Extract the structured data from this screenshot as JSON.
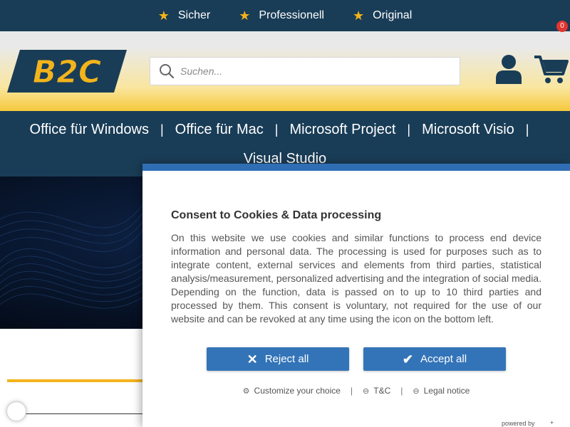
{
  "topbar": {
    "items": [
      {
        "icon": "star-icon",
        "label": "Sicher"
      },
      {
        "icon": "star-icon",
        "label": "Professionell"
      },
      {
        "icon": "star-icon",
        "label": "Original"
      }
    ]
  },
  "header": {
    "logo_text": "B2C",
    "search": {
      "placeholder": "Suchen...",
      "value": ""
    },
    "cart": {
      "count": "0"
    }
  },
  "nav": {
    "items": [
      {
        "label": "Office für Windows"
      },
      {
        "label": "Office für Mac"
      },
      {
        "label": "Microsoft Project"
      },
      {
        "label": "Microsoft Visio"
      },
      {
        "label": "Visual Studio"
      }
    ],
    "separator": "|"
  },
  "consent": {
    "title": "Consent to Cookies & Data processing",
    "body": "On this website we use cookies and similar functions to process end device information and personal data. The processing is used for purposes such as to integrate content, external services and elements from third parties, statistical analysis/measurement, personalized advertising and the integration of social media. Depending on the function, data is passed on to up to 10 third parties and processed by them. This consent is voluntary, not required for the use of our website and can be revoked at any time using the icon on the bottom left.",
    "reject_label": "Reject all",
    "accept_label": "Accept all",
    "links": {
      "customize": "Customize your choice",
      "tc": "T&C",
      "legal": "Legal notice",
      "separator": "|"
    },
    "powered_by": "powered by",
    "powered_plus": "+"
  },
  "colors": {
    "navy": "#1a3d57",
    "star": "#f2b31b",
    "button_blue": "#3373b8",
    "badge_red": "#e3342f"
  }
}
